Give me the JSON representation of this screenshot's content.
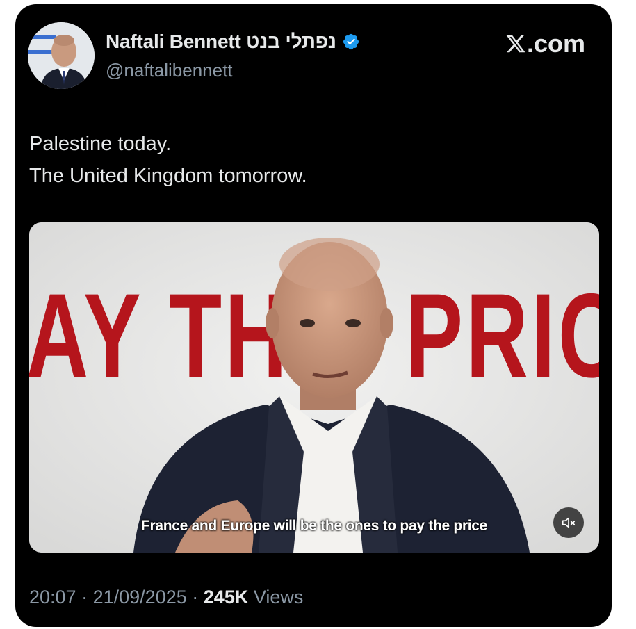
{
  "tweet": {
    "display_name": "Naftali Bennett נפתלי בנט",
    "handle": "@naftalibennett",
    "verified": true,
    "brand": ".com",
    "brand_icon": "x-logo-icon",
    "text_lines": [
      "Palestine today.",
      "The United Kingdom tomorrow."
    ],
    "time": "20:07",
    "separator": "·",
    "date": "21/09/2025",
    "views_count": "245K",
    "views_label": "Views"
  },
  "media": {
    "backdrop_text_left": "AY TH",
    "backdrop_text_right": "PRIC",
    "caption": "France and Europe will be the ones to pay the price",
    "mute_icon": "speaker-muted-icon"
  },
  "colors": {
    "background": "#000000",
    "verified_blue": "#1d9bf0",
    "backdrop_red": "#b5151c",
    "primary_text": "#e7e9ea",
    "secondary_text": "#8b98a5"
  }
}
